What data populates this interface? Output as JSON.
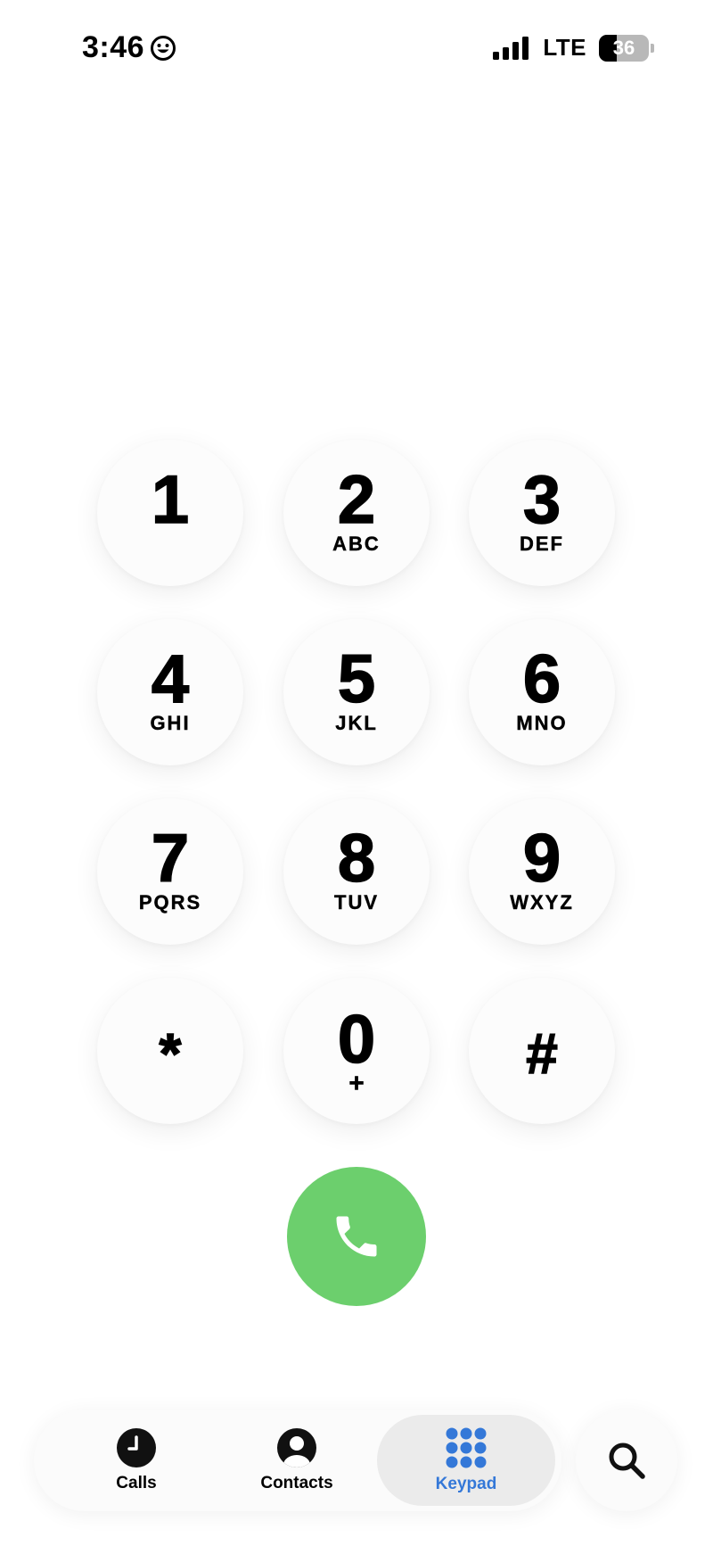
{
  "status_bar": {
    "time": "3:46",
    "network": "LTE",
    "battery_level": "36",
    "battery_fraction": 0.36
  },
  "keypad": {
    "keys": [
      {
        "digit": "1",
        "letters": ""
      },
      {
        "digit": "2",
        "letters": "ABC"
      },
      {
        "digit": "3",
        "letters": "DEF"
      },
      {
        "digit": "4",
        "letters": "GHI"
      },
      {
        "digit": "5",
        "letters": "JKL"
      },
      {
        "digit": "6",
        "letters": "MNO"
      },
      {
        "digit": "7",
        "letters": "PQRS"
      },
      {
        "digit": "8",
        "letters": "TUV"
      },
      {
        "digit": "9",
        "letters": "WXYZ"
      },
      {
        "digit": "*",
        "letters": ""
      },
      {
        "digit": "0",
        "letters": "+"
      },
      {
        "digit": "#",
        "letters": ""
      }
    ]
  },
  "call_button": {
    "icon": "phone-icon",
    "color": "#6ccf6d"
  },
  "tab_bar": {
    "tabs": [
      {
        "label": "Calls",
        "icon": "clock-icon",
        "active": false
      },
      {
        "label": "Contacts",
        "icon": "person-icon",
        "active": false
      },
      {
        "label": "Keypad",
        "icon": "keypad-grid-icon",
        "active": true
      }
    ],
    "active_color": "#3478d8"
  },
  "search": {
    "icon": "search-icon"
  }
}
